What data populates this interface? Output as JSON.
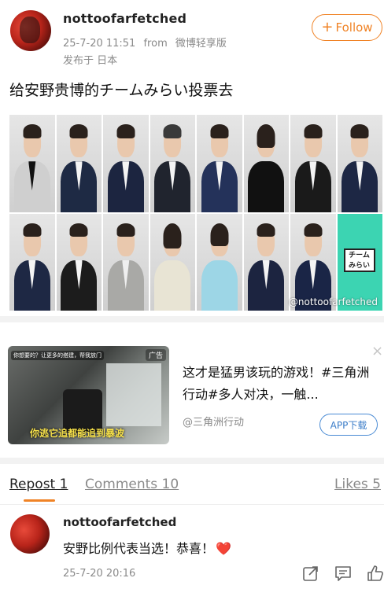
{
  "post": {
    "username": "nottoofarfetched",
    "timestamp": "25-7-20 11:51",
    "source_prefix": "from",
    "source": "微博轻享版",
    "location": "发布于 日本",
    "follow_label": "Follow",
    "text": "给安野贵博的チームみらい投票去",
    "watermark": "@nottoofarfetched",
    "logo_text": "チーム\nみらい"
  },
  "ad": {
    "topbar": "你想要的？让更多的搭建，帮我放门",
    "tag": "广告",
    "caption": "你逃它追都能追到暴波",
    "title": "这才是猛男该玩的游戏！#三角洲行动#多人对决，一触...",
    "source": "@三角洲行动",
    "cta": "APP下载",
    "close": "×"
  },
  "tabs": {
    "repost": "Repost 1",
    "comments": "Comments 10",
    "likes": "Likes 5"
  },
  "comment": {
    "username": "nottoofarfetched",
    "text": "安野比例代表当选！恭喜！",
    "heart": "❤️",
    "time": "25-7-20 20:16"
  },
  "colors": {
    "accent": "#f08326",
    "link_blue": "#3a7cc8",
    "heart": "#e0262b",
    "logo_teal": "#3cd4b2"
  }
}
